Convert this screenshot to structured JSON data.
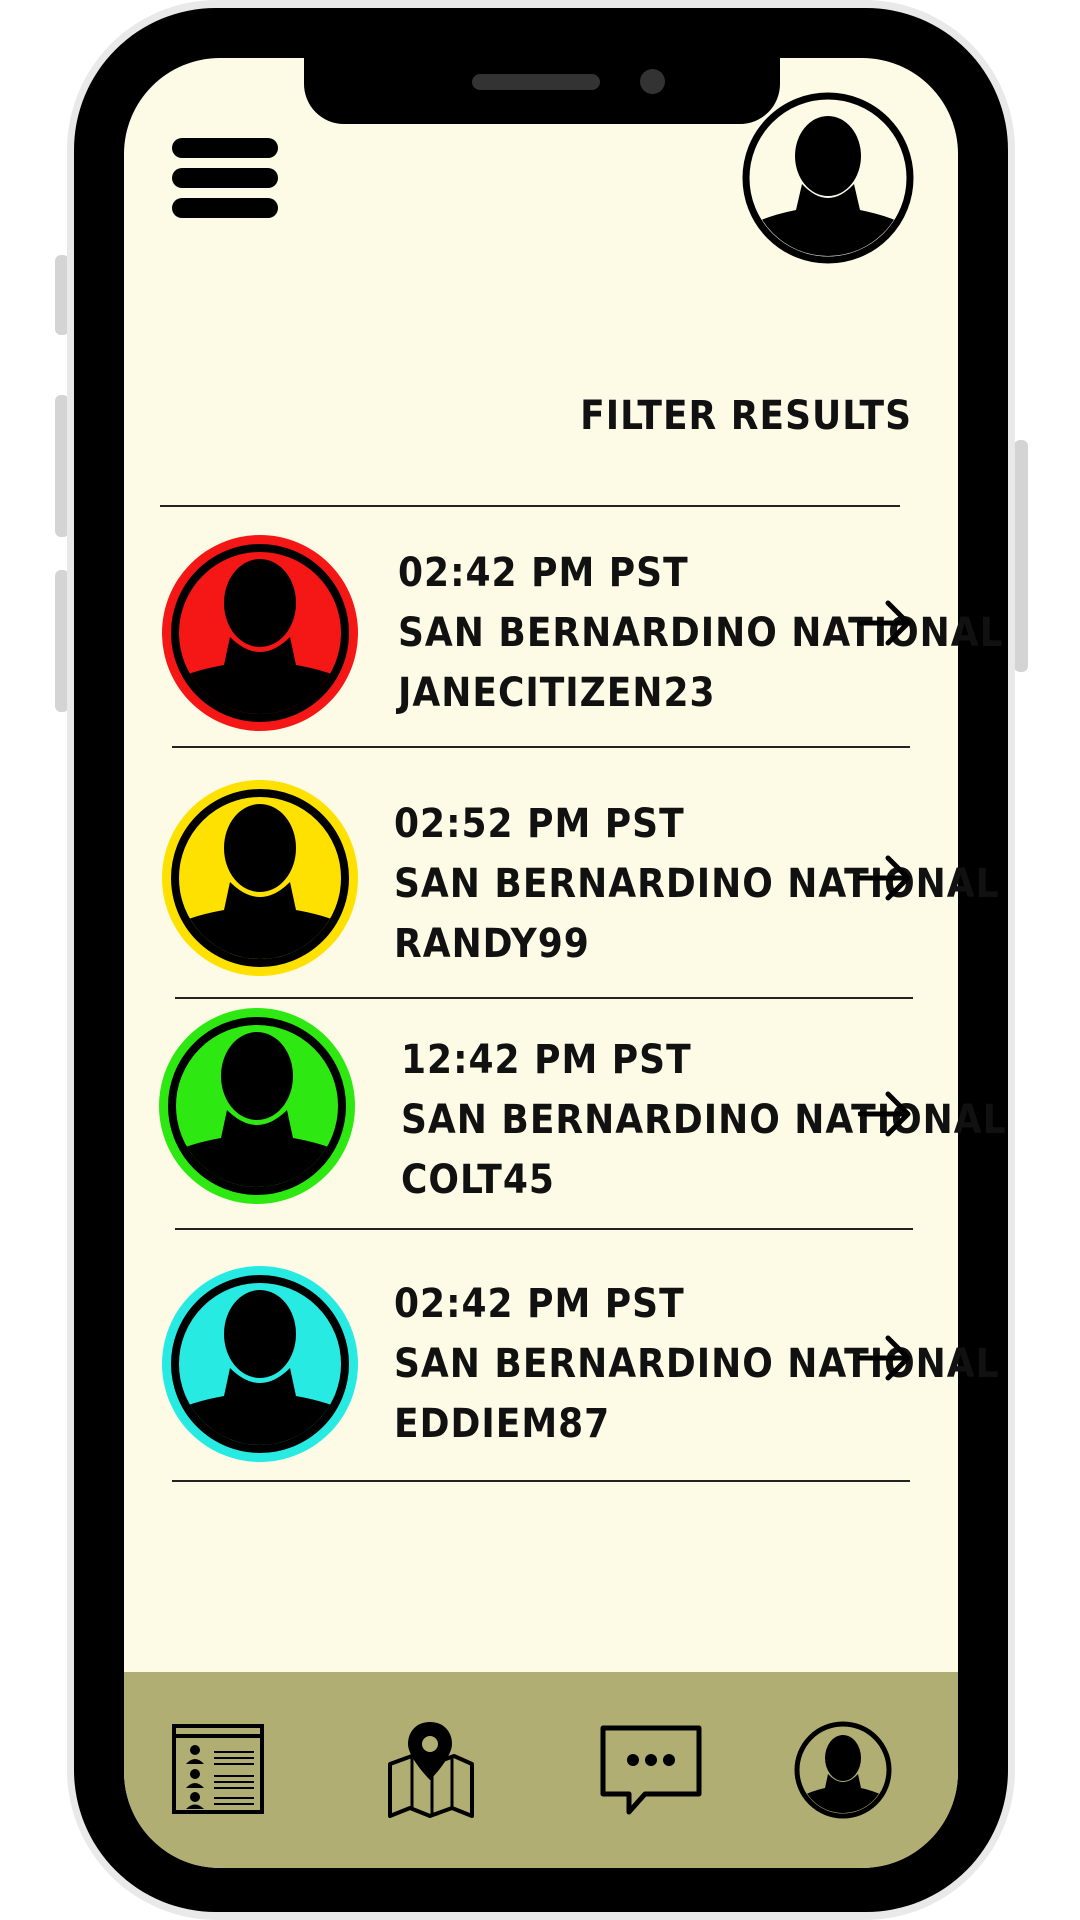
{
  "header": {
    "filter_label": "FILTER RESULTS"
  },
  "colors": {
    "screen_bg": "#fdfbe6",
    "navbar_bg": "#b1ae74",
    "status_red": "#f51616",
    "status_yellow": "#ffe100",
    "status_green": "#2ee812",
    "status_cyan": "#27ebe3"
  },
  "results": [
    {
      "time": "02:42 PM PST",
      "location": "SAN BERNARDINO NATIONAL",
      "user": "JANECITIZEN23",
      "status_color": "#f51616"
    },
    {
      "time": "02:52 PM PST",
      "location": "SAN BERNARDINO NATIONAL",
      "user": "RANDY99",
      "status_color": "#ffe100"
    },
    {
      "time": "12:42 PM PST",
      "location": "SAN BERNARDINO NATIONAL",
      "user": "COLT45",
      "status_color": "#2ee812"
    },
    {
      "time": "02:42 PM PST",
      "location": "SAN BERNARDINO NATIONAL",
      "user": "EDDIEM87",
      "status_color": "#27ebe3"
    }
  ],
  "navbar": {
    "items": [
      "list-icon",
      "map-icon",
      "chat-icon",
      "profile-icon"
    ]
  }
}
